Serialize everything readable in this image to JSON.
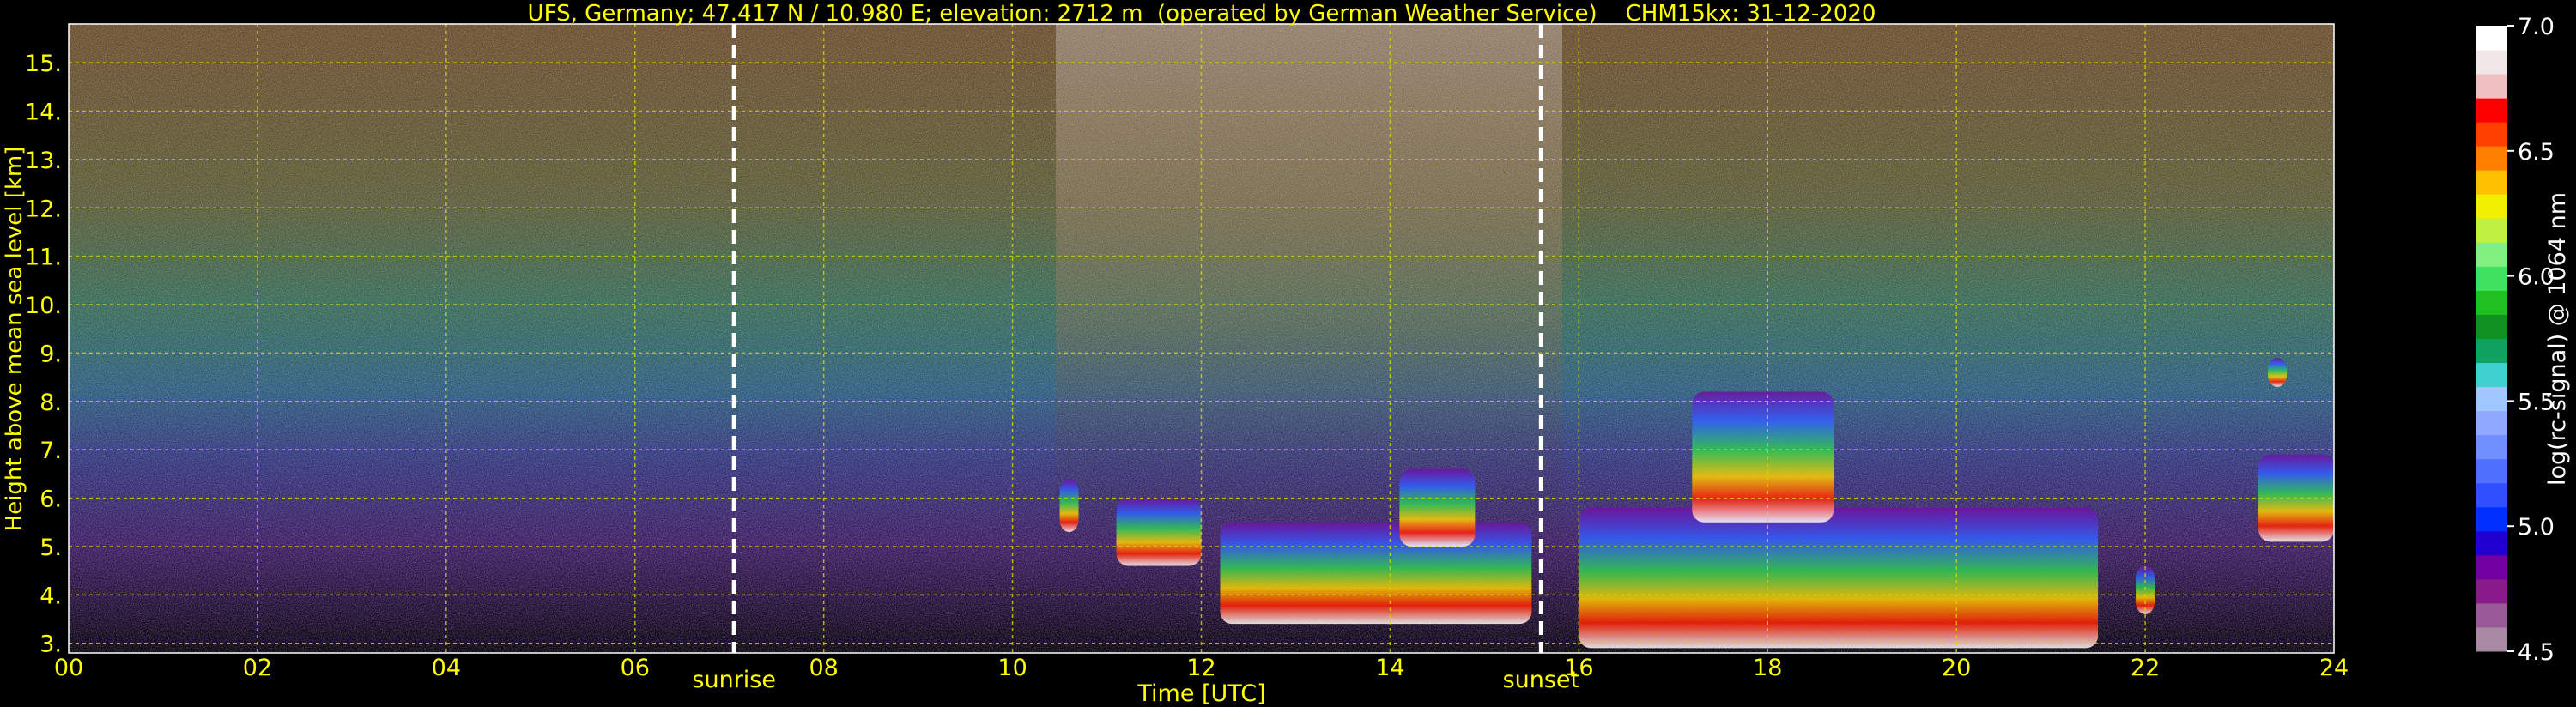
{
  "chart_data": {
    "type": "heatmap",
    "title": "UFS, Germany; 47.417 N / 10.980 E; elevation: 2712 m  (operated by German Weather Service)    CHM15kx: 31-12-2020",
    "xlabel": "Time [UTC]",
    "ylabel": "Height above mean sea level [km]",
    "xlim": [
      0,
      24
    ],
    "ylim": [
      2.8,
      15.8
    ],
    "x_ticks": [
      "00",
      "02",
      "04",
      "06",
      "08",
      "10",
      "12",
      "14",
      "16",
      "18",
      "20",
      "22",
      "24"
    ],
    "y_ticks": [
      "3.",
      "4.",
      "5.",
      "6.",
      "7.",
      "8.",
      "9.",
      "10.",
      "11.",
      "12.",
      "13.",
      "14.",
      "15."
    ],
    "grid": true,
    "markers": [
      {
        "label": "sunrise",
        "x": 7.05
      },
      {
        "label": "sunset",
        "x": 15.6
      }
    ],
    "colorbar": {
      "label": "log(rc-signal) @ 1064 nm",
      "range": [
        4.5,
        7.0
      ],
      "ticks": [
        "4.5",
        "5.0",
        "5.5",
        "6.0",
        "6.5",
        "7.0"
      ],
      "colors": [
        "#a88aa4",
        "#9a5a9a",
        "#8a1a8a",
        "#7000a0",
        "#2000d0",
        "#0030ff",
        "#3050ff",
        "#5070ff",
        "#7090ff",
        "#90a8ff",
        "#a0c8ff",
        "#40d0d0",
        "#10a060",
        "#109020",
        "#20c020",
        "#40e060",
        "#80f080",
        "#c0f040",
        "#f0f000",
        "#ffc000",
        "#ff8000",
        "#ff4000",
        "#ff0000",
        "#f0c0c0",
        "#f0e8e8",
        "#ffffff"
      ]
    },
    "cloud_layers": [
      {
        "t0": 10.5,
        "t1": 10.7,
        "base": 5.3,
        "top": 6.4
      },
      {
        "t0": 11.1,
        "t1": 12.0,
        "base": 4.6,
        "top": 6.0
      },
      {
        "t0": 12.2,
        "t1": 15.5,
        "base": 3.4,
        "top": 5.5
      },
      {
        "t0": 14.1,
        "t1": 14.9,
        "base": 5.0,
        "top": 6.6
      },
      {
        "t0": 16.0,
        "t1": 21.5,
        "base": 2.9,
        "top": 5.8
      },
      {
        "t0": 17.2,
        "t1": 18.7,
        "base": 5.5,
        "top": 8.2
      },
      {
        "t0": 21.9,
        "t1": 22.1,
        "base": 3.6,
        "top": 4.6
      },
      {
        "t0": 23.2,
        "t1": 24.0,
        "base": 5.1,
        "top": 6.9
      },
      {
        "t0": 23.3,
        "t1": 23.5,
        "base": 8.3,
        "top": 8.9
      }
    ]
  }
}
